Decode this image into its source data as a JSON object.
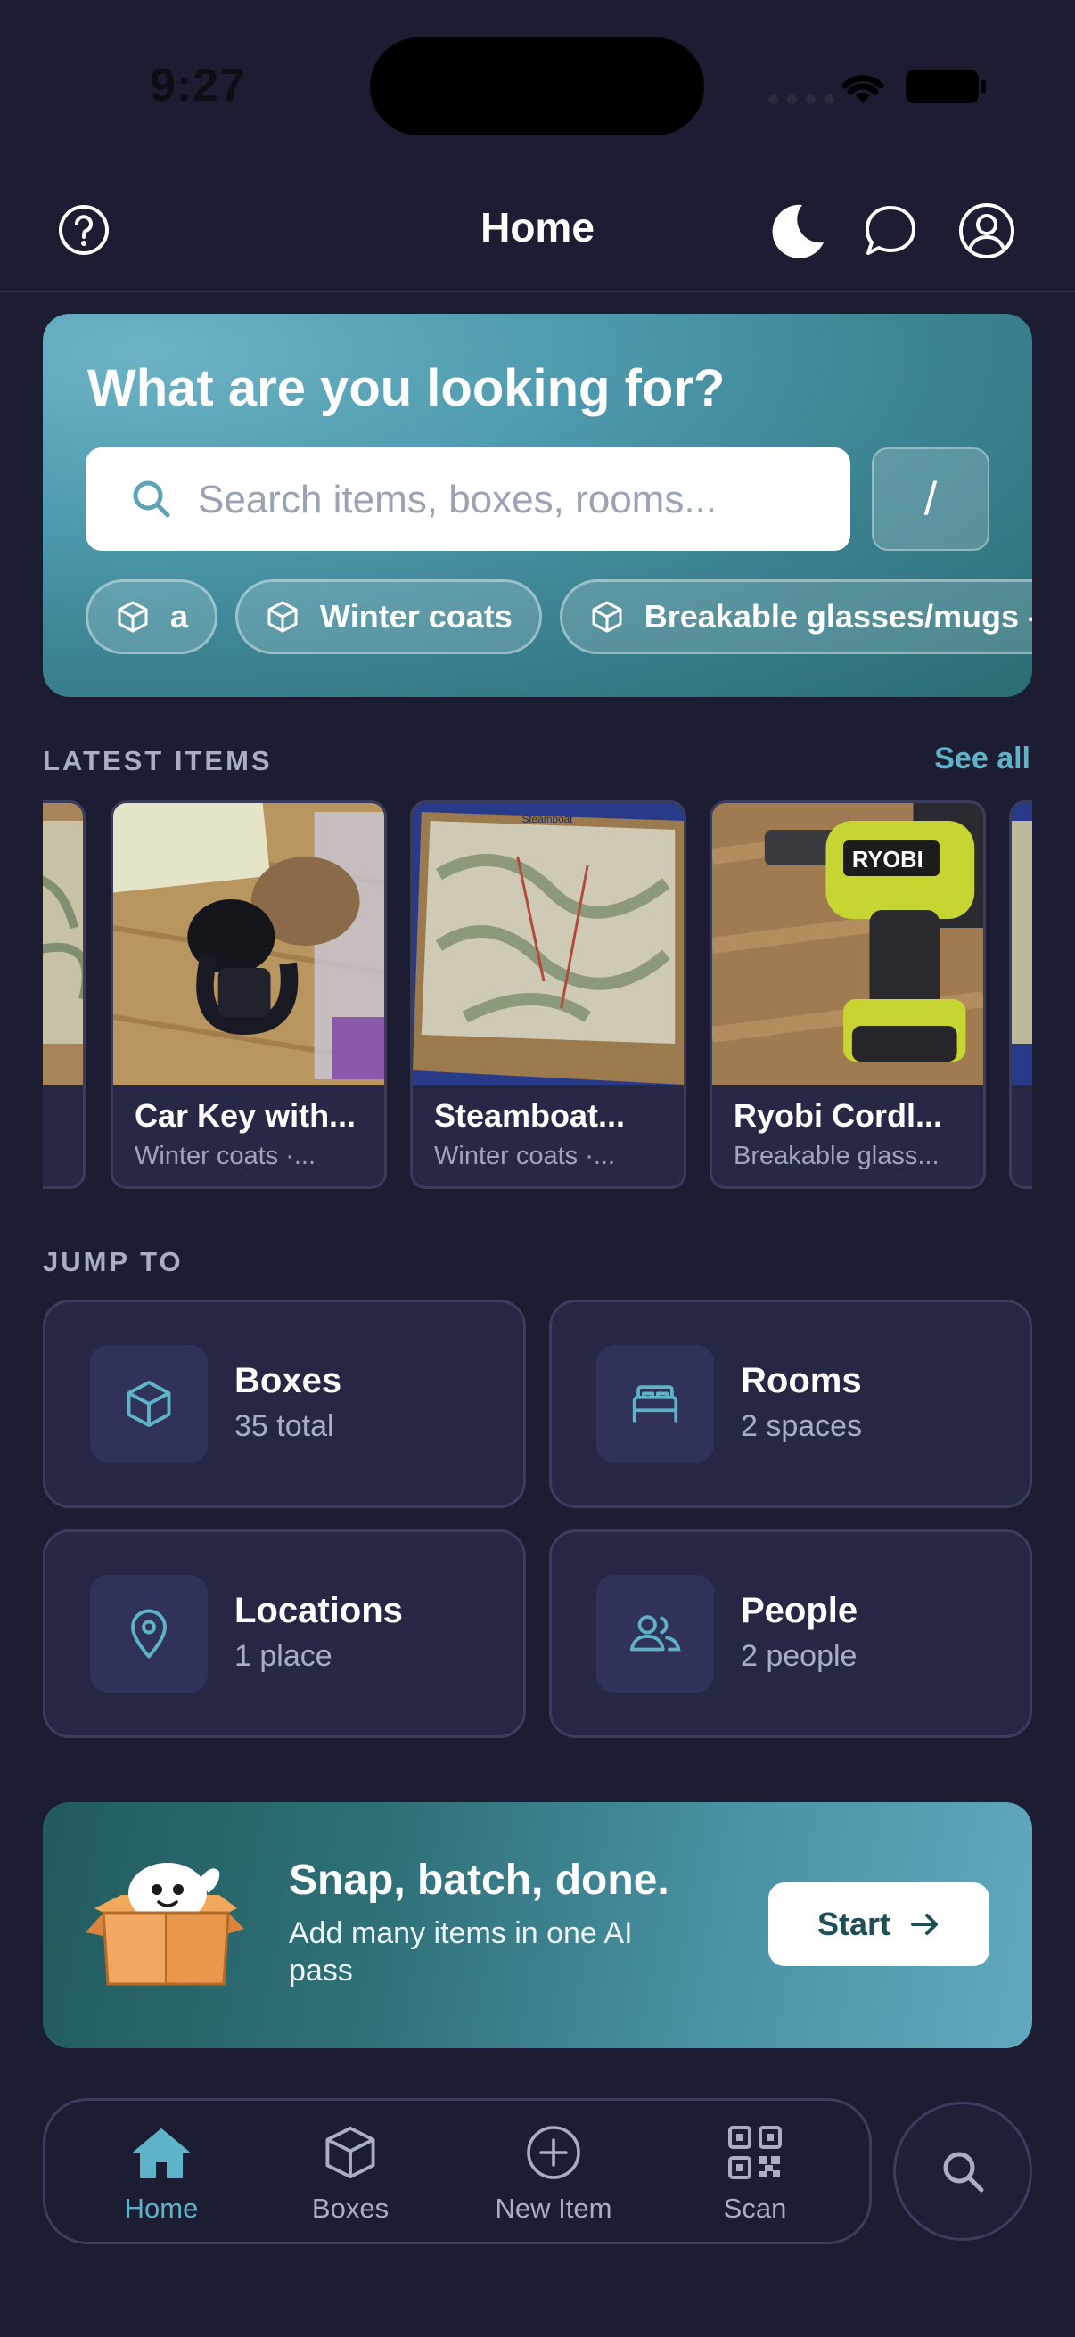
{
  "status_bar": {
    "time": "9:27"
  },
  "header": {
    "title": "Home"
  },
  "hero": {
    "question": "What are you looking for?",
    "search_placeholder": "Search items, boxes, rooms...",
    "slash_label": "/",
    "chips": [
      {
        "label": "a",
        "icon": "box-icon"
      },
      {
        "label": "Winter coats",
        "icon": "box-icon"
      },
      {
        "label": "Breakable glasses/mugs -",
        "icon": "box-icon"
      }
    ]
  },
  "latest": {
    "label": "LATEST ITEMS",
    "see_all": "See all",
    "items": [
      {
        "name": "Car Key with...",
        "sub": "Winter coats ·..."
      },
      {
        "name": "Steamboat...",
        "sub": "Winter coats ·..."
      },
      {
        "name": "Ryobi Cordl...",
        "sub": "Breakable glass..."
      }
    ]
  },
  "jump": {
    "label": "JUMP TO",
    "tiles": [
      {
        "title": "Boxes",
        "sub": "35 total",
        "icon": "box-icon"
      },
      {
        "title": "Rooms",
        "sub": "2 spaces",
        "icon": "bed-icon"
      },
      {
        "title": "Locations",
        "sub": "1 place",
        "icon": "location-pin-icon"
      },
      {
        "title": "People",
        "sub": "2 people",
        "icon": "people-icon"
      }
    ]
  },
  "promo": {
    "title": "Snap, batch, done.",
    "subtitle": "Add many items in one AI pass",
    "button": "Start"
  },
  "nav": {
    "items": [
      {
        "label": "Home",
        "icon": "home-icon",
        "active": true
      },
      {
        "label": "Boxes",
        "icon": "box-icon"
      },
      {
        "label": "New Item",
        "icon": "plus-circle-icon"
      },
      {
        "label": "Scan",
        "icon": "qr-code-icon"
      }
    ]
  },
  "colors": {
    "background": "#1c1c33",
    "accent": "#5fb3c9",
    "card": "#262645"
  }
}
